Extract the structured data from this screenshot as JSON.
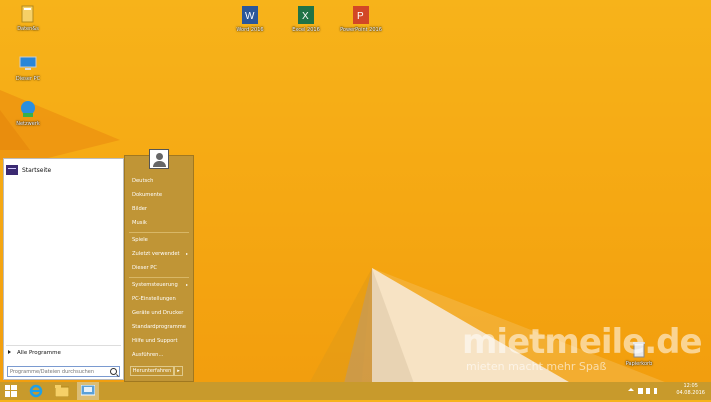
{
  "desktop": {
    "icons": [
      {
        "name": "folder",
        "label": "Daten&s"
      },
      {
        "name": "computer",
        "label": "Dieser PC"
      },
      {
        "name": "network",
        "label": "Netzwerk"
      },
      {
        "name": "word",
        "label": "Word 2016"
      },
      {
        "name": "excel",
        "label": "Excel 2016"
      },
      {
        "name": "powerpoint",
        "label": "PowerPoint 2016"
      },
      {
        "name": "recycle-bin",
        "label": "Papierkorb"
      }
    ]
  },
  "start_menu": {
    "pinned": [
      {
        "label": "Startseite"
      }
    ],
    "all_programs_label": "Alle Programme",
    "search_placeholder": "Programme/Dateien durchsuchen",
    "right_items": [
      {
        "label": "Deutsch"
      },
      {
        "label": "Dokumente"
      },
      {
        "label": "Bilder"
      },
      {
        "label": "Musik"
      },
      {
        "label": "Spiele"
      },
      {
        "label": "Zuletzt verwendet"
      },
      {
        "label": "Dieser PC"
      },
      {
        "label": "Systemsteuerung"
      },
      {
        "label": "PC-Einstellungen"
      },
      {
        "label": "Geräte und Drucker"
      },
      {
        "label": "Standardprogramme"
      },
      {
        "label": "Hilfe und Support"
      },
      {
        "label": "Ausführen..."
      }
    ],
    "shutdown_label": "Herunterfahren",
    "submenu_arrow": "▸"
  },
  "taskbar": {
    "clock_time": "12:05",
    "clock_date": "04.08.2016",
    "start_icon": "windows-logo",
    "pinned": [
      "internet-explorer",
      "file-explorer",
      "start-menu-program"
    ]
  },
  "watermark": {
    "line1": "mietmeile.de",
    "line2": "mieten macht mehr Spaß"
  },
  "colors": {
    "wallpaper": "#f5a712",
    "start_right": "#c09536",
    "taskbar": "#c89a2c"
  }
}
